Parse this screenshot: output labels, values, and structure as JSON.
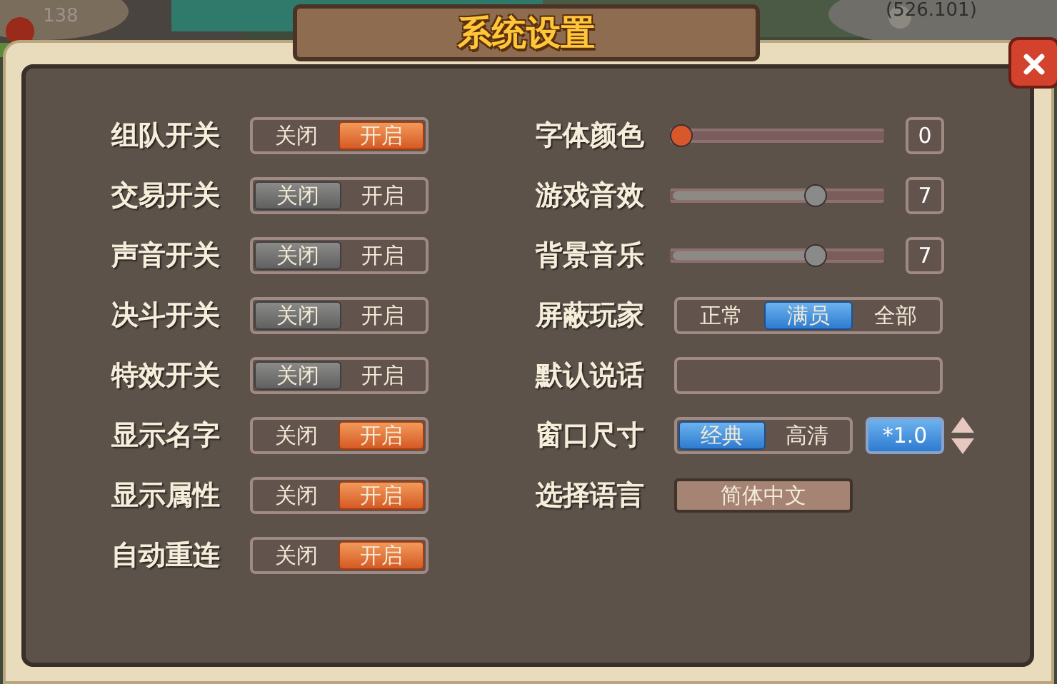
{
  "hud": {
    "count": "138",
    "coords": "(526.101)"
  },
  "title": "系统设置",
  "switches": [
    {
      "label": "组队开关",
      "options": [
        {
          "text": "关闭",
          "selected": false
        },
        {
          "text": "开启",
          "selected": true
        }
      ]
    },
    {
      "label": "交易开关",
      "options": [
        {
          "text": "关闭",
          "selected": true
        },
        {
          "text": "开启",
          "selected": false
        }
      ]
    },
    {
      "label": "声音开关",
      "options": [
        {
          "text": "关闭",
          "selected": true
        },
        {
          "text": "开启",
          "selected": false
        }
      ]
    },
    {
      "label": "决斗开关",
      "options": [
        {
          "text": "关闭",
          "selected": true
        },
        {
          "text": "开启",
          "selected": false
        }
      ]
    },
    {
      "label": "特效开关",
      "options": [
        {
          "text": "关闭",
          "selected": true
        },
        {
          "text": "开启",
          "selected": false
        }
      ]
    },
    {
      "label": "显示名字",
      "options": [
        {
          "text": "关闭",
          "selected": false
        },
        {
          "text": "开启",
          "selected": true
        }
      ]
    },
    {
      "label": "显示属性",
      "options": [
        {
          "text": "关闭",
          "selected": false
        },
        {
          "text": "开启",
          "selected": true
        }
      ]
    },
    {
      "label": "自动重连",
      "options": [
        {
          "text": "关闭",
          "selected": false
        },
        {
          "text": "开启",
          "selected": true
        }
      ]
    }
  ],
  "settings": [
    {
      "kind": "slider",
      "label": "字体颜色",
      "level": 0,
      "reading": "0",
      "color": "#d9582b"
    },
    {
      "kind": "slider",
      "label": "游戏音效",
      "level": 0.7,
      "reading": "7",
      "color": "#8a8a8a"
    },
    {
      "kind": "slider",
      "label": "背景音乐",
      "level": 0.7,
      "reading": "7",
      "color": "#8a8a8a"
    },
    {
      "kind": "segmented",
      "label": "屏蔽玩家",
      "options": [
        {
          "text": "正常",
          "selected": false
        },
        {
          "text": "满员",
          "selected": true
        },
        {
          "text": "全部",
          "selected": false
        }
      ]
    },
    {
      "kind": "text_field",
      "label": "默认说话"
    },
    {
      "kind": "scale",
      "label": "窗口尺寸",
      "options": [
        {
          "text": "经典",
          "selected": true
        },
        {
          "text": "高清",
          "selected": false
        }
      ],
      "scale": "*1.0"
    },
    {
      "kind": "button",
      "label": "选择语言",
      "text": "简体中文"
    }
  ]
}
